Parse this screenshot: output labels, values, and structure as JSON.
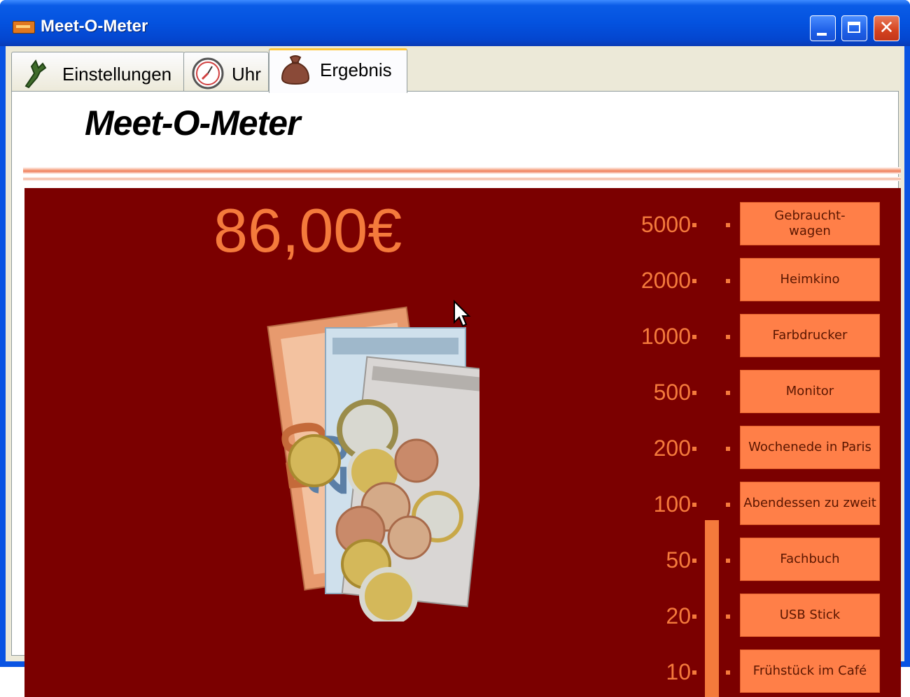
{
  "window": {
    "title": "Meet-O-Meter",
    "close_glyph": "✕"
  },
  "tabs": [
    {
      "label": "Einstellungen",
      "icon": "wrench-icon"
    },
    {
      "label": "Uhr",
      "icon": "clock-icon"
    },
    {
      "label": "Ergebnis",
      "icon": "money-bag-icon",
      "selected": true
    }
  ],
  "header": {
    "title": "Meet-O-Meter"
  },
  "result": {
    "amount": "86,00€"
  },
  "meter": {
    "level_value": 86
  },
  "scale": [
    {
      "value": "5000",
      "item": "Gebraucht-\nwagen"
    },
    {
      "value": "2000",
      "item": "Heimkino"
    },
    {
      "value": "1000",
      "item": "Farbdrucker"
    },
    {
      "value": "500",
      "item": "Monitor"
    },
    {
      "value": "200",
      "item": "Wochenede in Paris"
    },
    {
      "value": "100",
      "item": "Abendessen zu zweit"
    },
    {
      "value": "50",
      "item": "Fachbuch"
    },
    {
      "value": "20",
      "item": "USB Stick"
    },
    {
      "value": "10",
      "item": "Frühstück im Café"
    }
  ],
  "colors": {
    "background": "#7b0000",
    "accent": "#f47a3c",
    "button": "#ff7f48"
  }
}
